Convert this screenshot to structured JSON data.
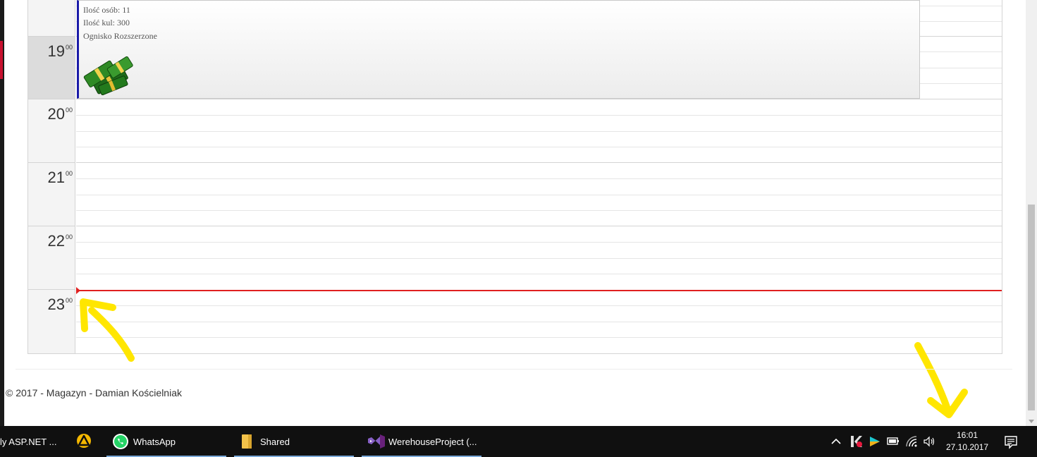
{
  "calendar": {
    "hours": [
      {
        "hour": "19",
        "minutes": "00"
      },
      {
        "hour": "20",
        "minutes": "00"
      },
      {
        "hour": "21",
        "minutes": "00"
      },
      {
        "hour": "22",
        "minutes": "00"
      },
      {
        "hour": "23",
        "minutes": "00"
      }
    ],
    "event": {
      "line1": "Ilość osób: 11",
      "line2": "Ilość kul: 300",
      "line3": "Ognisko Rozszerzone",
      "icon": "money-stack-icon",
      "border_color": "#1a1aa8"
    },
    "current_time_color": "#e02020"
  },
  "footer": {
    "text": "© 2017 - Magazyn - Damian Kościelniak"
  },
  "taskbar": {
    "items": [
      {
        "label": "ly ASP.NET ..."
      },
      {
        "label": ""
      },
      {
        "label": "WhatsApp"
      },
      {
        "label": "Shared"
      },
      {
        "label": "WerehouseProject (..."
      }
    ],
    "clock_time": "16:01",
    "clock_date": "27.10.2017"
  },
  "annotations": {
    "arrow_color": "#ffe600"
  }
}
